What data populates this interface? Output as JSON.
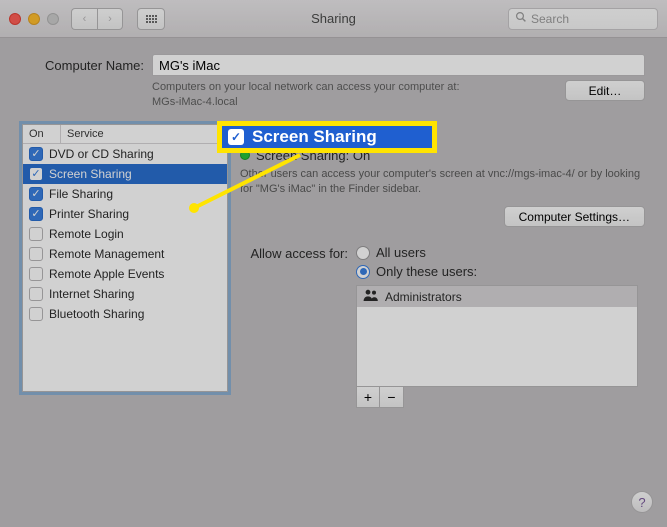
{
  "window": {
    "title": "Sharing",
    "search_placeholder": "Search"
  },
  "computer_name": {
    "label": "Computer Name:",
    "value": "MG's iMac",
    "help_line1": "Computers on your local network can access your computer at:",
    "help_line2": "MGs-iMac-4.local",
    "edit_label": "Edit…"
  },
  "list_headers": {
    "on": "On",
    "service": "Service"
  },
  "services": [
    {
      "label": "DVD or CD Sharing",
      "on": true,
      "selected": false
    },
    {
      "label": "Screen Sharing",
      "on": true,
      "selected": true
    },
    {
      "label": "File Sharing",
      "on": true,
      "selected": false
    },
    {
      "label": "Printer Sharing",
      "on": true,
      "selected": false
    },
    {
      "label": "Remote Login",
      "on": false,
      "selected": false
    },
    {
      "label": "Remote Management",
      "on": false,
      "selected": false
    },
    {
      "label": "Remote Apple Events",
      "on": false,
      "selected": false
    },
    {
      "label": "Internet Sharing",
      "on": false,
      "selected": false
    },
    {
      "label": "Bluetooth Sharing",
      "on": false,
      "selected": false
    }
  ],
  "detail": {
    "status_title": "Screen Sharing: On",
    "status_help": "Other users can access your computer's screen at vnc://mgs-imac-4/ or by looking for \"MG's iMac\" in the Finder sidebar.",
    "computer_settings_label": "Computer Settings…",
    "access_label": "Allow access for:",
    "radio_all": "All users",
    "radio_only": "Only these users:",
    "selected_radio": "only",
    "users": [
      {
        "name": "Administrators"
      }
    ],
    "add_label": "+",
    "remove_label": "−"
  },
  "callout": {
    "label": "Screen Sharing"
  }
}
